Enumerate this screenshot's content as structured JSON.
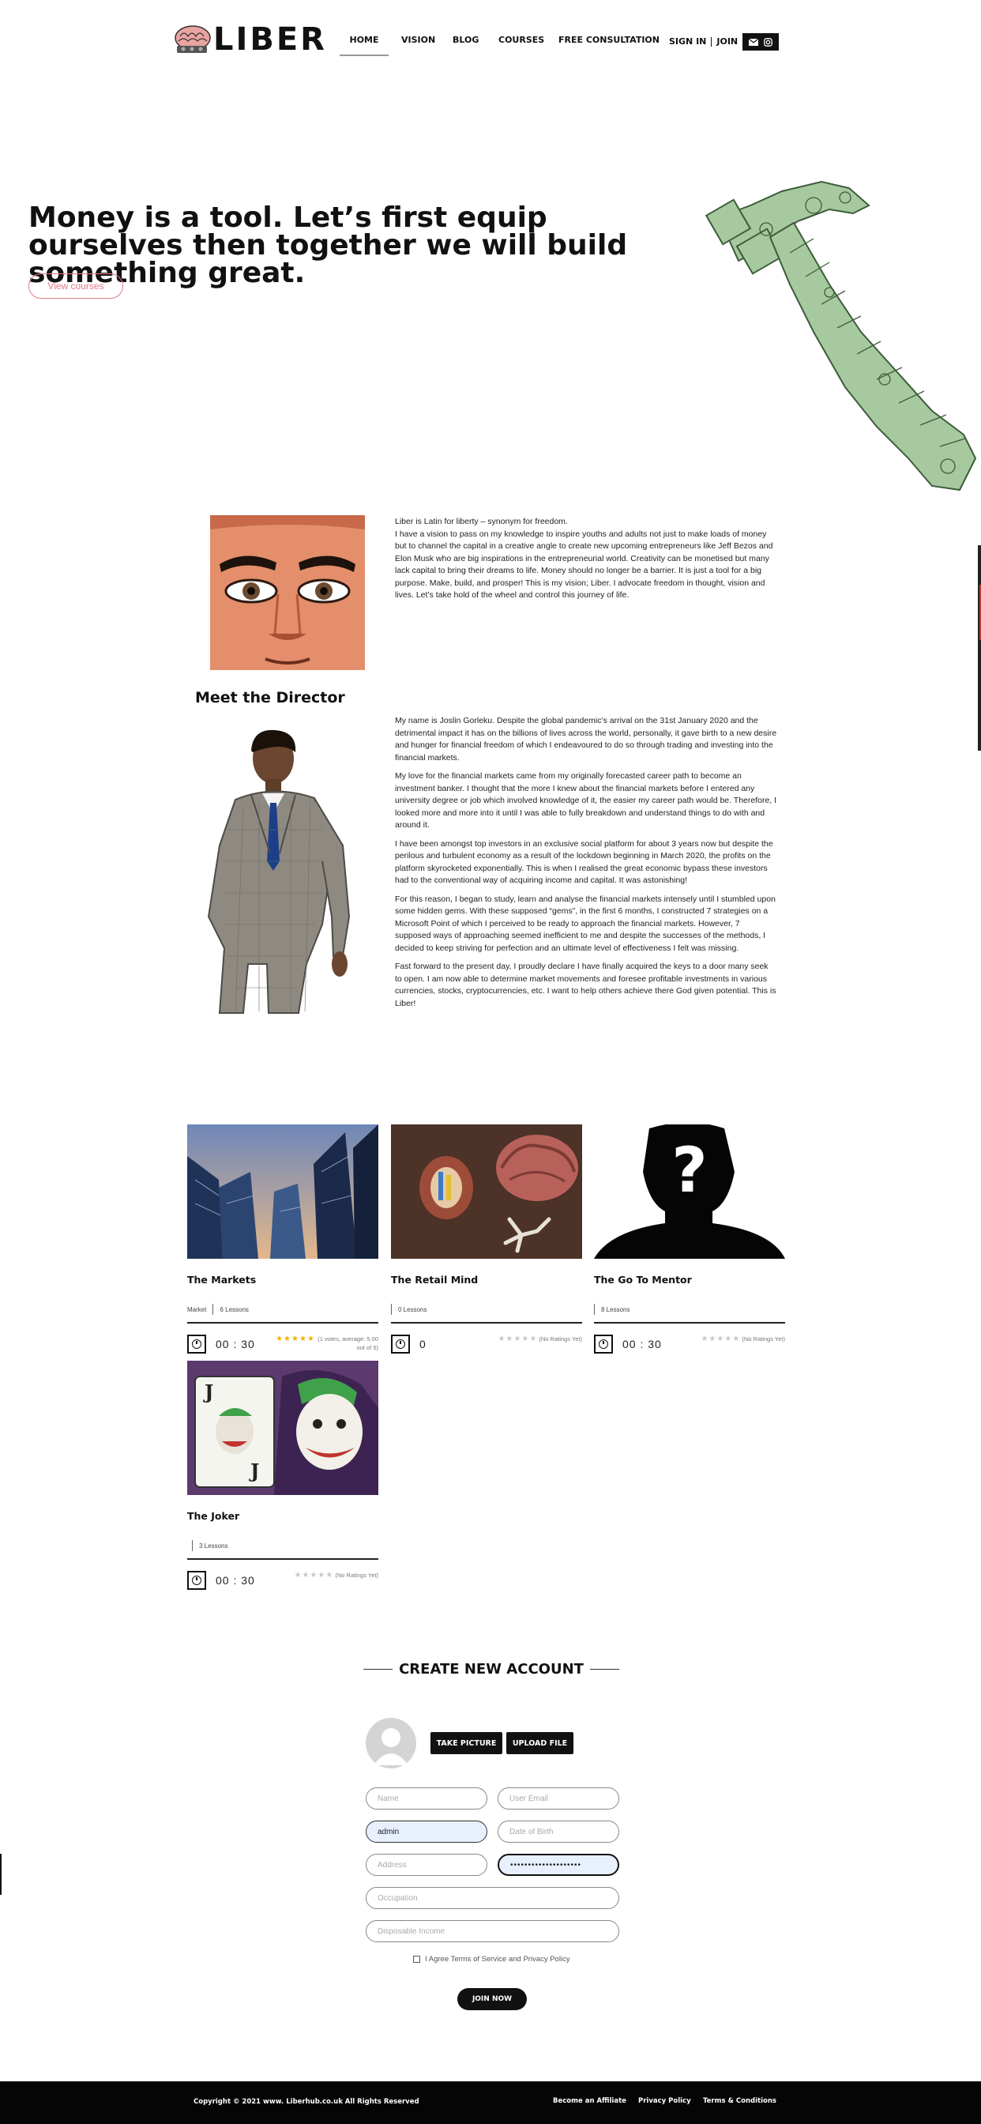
{
  "header": {
    "logo_text": "LIBER",
    "nav": [
      "HOME",
      "VISION",
      "BLOG",
      "COURSES",
      "FREE CONSULTATION"
    ],
    "sign_in": "SIGN IN",
    "join": "JOIN",
    "social_icons": [
      "envelope-icon",
      "instagram-icon"
    ]
  },
  "hero": {
    "title": "Money is a tool. Let’s first equip ourselves then together we will build something great.",
    "button": "View courses",
    "accent_color": "#e07b86"
  },
  "about": {
    "text_line1": "Liber is Latin for liberty – synonym for freedom.",
    "text_body": "I have a vision to pass on my knowledge to inspire youths and adults not just to make loads of money but to channel the capital in a creative angle to create new upcoming entrepreneurs like Jeff Bezos and Elon Musk who are big inspirations in the entrepreneurial world. Creativity can be monetised but many lack capital to bring their dreams to life. Money should no longer be a barrier. It is just a tool for a big purpose. Make, build, and prosper! This is my vision; Liber. I advocate freedom in thought, vision and lives. Let’s take hold of the wheel and control this journey of life."
  },
  "director": {
    "heading": "Meet the Director",
    "paragraphs": [
      "My name is Joslin Gorleku. Despite the global pandemic’s arrival on the 31st January 2020 and the detrimental impact it has on the billions of lives across the world, personally, it gave birth to a new desire and hunger for financial freedom of which I endeavoured to do so through trading and investing into the financial markets.",
      "My love for the financial markets came from my originally forecasted career path to become an investment banker. I thought that the more I knew about the financial markets before I entered any university degree or job which involved knowledge of it, the easier my career path would be. Therefore, I looked more and more into it until I was able to fully breakdown and understand things to do with and around it.",
      "I have been amongst top investors in an exclusive social platform for about 3 years now but despite the perilous and turbulent economy as a result of the lockdown beginning in March 2020, the profits on the platform skyrocketed exponentially. This is when I realised the great economic bypass these investors had to the conventional way of acquiring income and capital. It was astonishing!",
      "For this reason, I began to study, learn and analyse the financial markets intensely until I stumbled upon some hidden gems. With these supposed “gems”, in the first 6 months, I constructed 7 strategies on a Microsoft Point of which I perceived to be ready to approach the financial markets. However, 7 supposed ways of approaching seemed inefficient to me and despite the successes of the methods, I decided to keep striving for perfection and an ultimate level of effectiveness I felt was missing.",
      "Fast forward to the present day, I proudly declare I have finally acquired the keys to a door many seek to open. I am now able to determine market movements and foresee profitable investments in various currencies, stocks, cryptocurrencies, etc. I want to help others achieve there God given potential. This is Liber!"
    ]
  },
  "courses": [
    {
      "title": "The Markets",
      "category": "Market",
      "lessons": "6 Lessons",
      "duration": "00 : 30",
      "rating_text": "(1 votes, average: 5.00 out of 5)",
      "stars": "★★★★★"
    },
    {
      "title": "The Retail Mind",
      "category": "",
      "lessons": "0 Lessons",
      "duration": "0",
      "rating_text": "(No Ratings Yet)",
      "stars": "★★★★★"
    },
    {
      "title": "The Go To Mentor",
      "category": "",
      "lessons": "8 Lessons",
      "duration": "00 : 30",
      "rating_text": "(No Ratings Yet)",
      "stars": "★★★★★"
    },
    {
      "title": "The Joker",
      "category": "",
      "lessons": "3 Lessons",
      "duration": "00 : 30",
      "rating_text": "(No Ratings Yet)",
      "stars": "★★★★★"
    }
  ],
  "signup": {
    "heading": "CREATE NEW ACCOUNT",
    "take_picture": "TAKE PICTURE",
    "upload_file": "UPLOAD FILE",
    "name_placeholder": "Name",
    "email_placeholder": "User Email",
    "username_value": "admin",
    "dob_placeholder": "Date of Birth",
    "address_placeholder": "Address",
    "password_value": "••••••••••••••••••••",
    "occupation_placeholder": "Occupation",
    "income_placeholder": "Disposable Income",
    "agree_text": "I Agree Terms of Service and Privacy Policy",
    "join_button": "JOIN NOW"
  },
  "footer": {
    "copyright": "Copyright © 2021 www. Liberhub.co.uk All Rights Reserved",
    "links": [
      "Become an Affiliate",
      "Privacy Policy",
      "Terms & Conditions"
    ]
  }
}
